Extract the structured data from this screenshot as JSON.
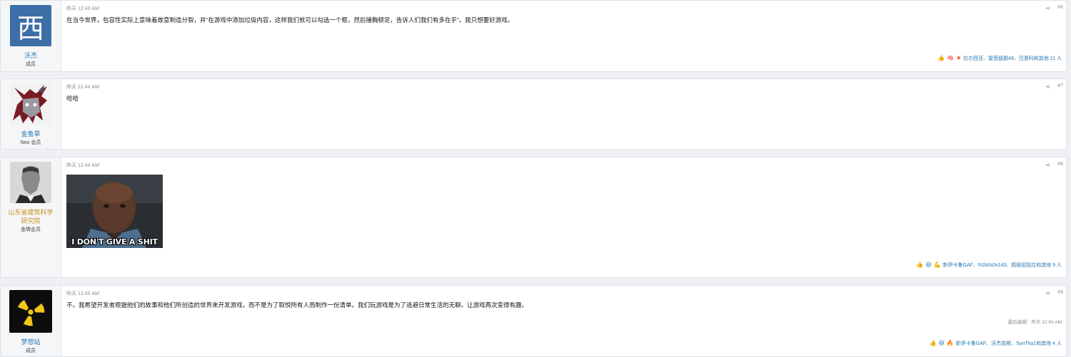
{
  "posts": [
    {
      "user": {
        "name": "沃杰",
        "title": "成员",
        "avatar_char": "西"
      },
      "time": "昨天 12:43 AM",
      "number": "#6",
      "text": "在当今世界，包容性实际上意味着故意制造分裂，并“在游戏中添加垃圾内容，这样我们就可以勾选一个框，然后捶胸顿足，告诉人们我们有多在乎”。我只想要好游戏。",
      "reactions": "拉尔西亚、雷音鼓鹅48、巴恩科和其他 11 人",
      "reaction_icons": [
        "thumbs-up-icon",
        "brain-icon",
        "sparkle-icon"
      ]
    },
    {
      "user": {
        "name": "金鱼草",
        "title": "Neo 会员"
      },
      "time": "昨天 12:44 AM",
      "number": "#7",
      "text": "哈哈"
    },
    {
      "user": {
        "name": "山东省建筑科学研究院",
        "title": "金牌会员"
      },
      "time": "昨天 12:44 AM",
      "number": "#8",
      "image_caption": "I DON'T GIVE A SHIT",
      "reactions": "新伊卡鲁GAF、N1b0s0x1d3、超级招技拉和其他 9 人",
      "reaction_icons": [
        "thumbs-up-icon",
        "laugh-icon",
        "muscle-icon"
      ]
    },
    {
      "user": {
        "name": "梦想站",
        "title": "成员"
      },
      "time": "昨天 12:45 AM",
      "number": "#9",
      "text": "不。我希望开发者根据他们的故事和他们所创造的世界来开发游戏，而不是为了取悦所有人而制作一份清单。我们玩游戏是为了逃避日常生活的无聊。让游戏再次变得有趣。",
      "edited": "最后编辑：昨天 12:45 AM",
      "reactions": "新伊卡鲁GAF、沃杰克斯、SynTha1和其他 4 人",
      "reaction_icons": [
        "thumbs-up-icon",
        "laugh-icon",
        "fire-icon"
      ]
    }
  ],
  "colors": {
    "link": "#2577b1",
    "gold": "#c6921a",
    "avatar_blue": "#3d6ea6"
  }
}
